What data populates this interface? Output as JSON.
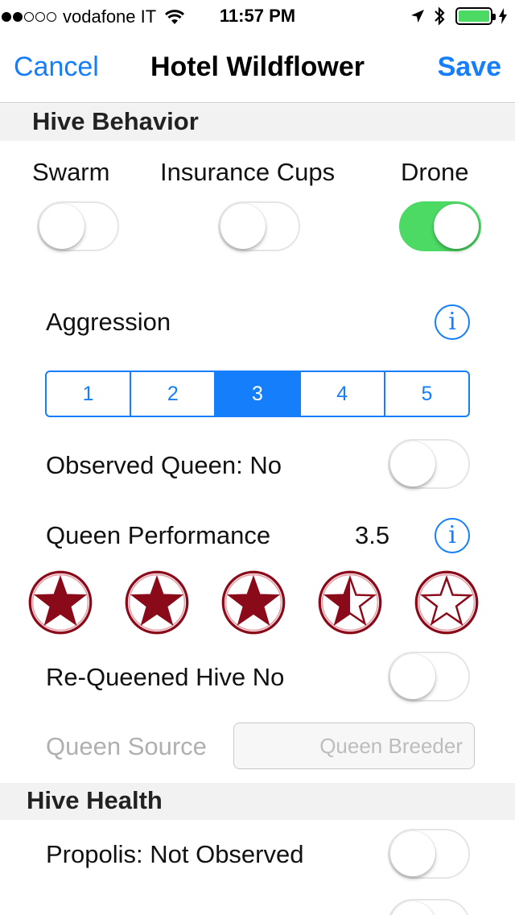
{
  "status_bar": {
    "carrier": "vodafone IT",
    "time": "11:57 PM",
    "signal_dots_filled": 2,
    "signal_dots_total": 5,
    "battery_level": 1.0,
    "battery_color": "#4cd964"
  },
  "nav": {
    "cancel_label": "Cancel",
    "title": "Hotel Wildflower",
    "save_label": "Save",
    "accent_color": "#157efb"
  },
  "hive_behavior": {
    "header": "Hive Behavior",
    "toggles": [
      {
        "label": "Swarm",
        "on": false
      },
      {
        "label": "Insurance Cups",
        "on": false
      },
      {
        "label": "Drone",
        "on": true
      }
    ],
    "aggression": {
      "label": "Aggression",
      "info_glyph": "i",
      "segments": [
        "1",
        "2",
        "3",
        "4",
        "5"
      ],
      "selected_index": 2
    },
    "observed_queen": {
      "label": "Observed Queen:  No",
      "on": false
    },
    "queen_performance": {
      "label": "Queen Performance",
      "value": "3.5",
      "info_glyph": "i",
      "rating": 3.5,
      "max": 5,
      "star_color": "#8b0a1a"
    },
    "requeened": {
      "label": "Re-Queened Hive  No",
      "on": false
    },
    "queen_source": {
      "label": "Queen Source",
      "placeholder": "Queen Breeder"
    }
  },
  "hive_health": {
    "header": "Hive Health",
    "propolis": {
      "label": "Propolis:  Not Observed",
      "on": false
    }
  }
}
